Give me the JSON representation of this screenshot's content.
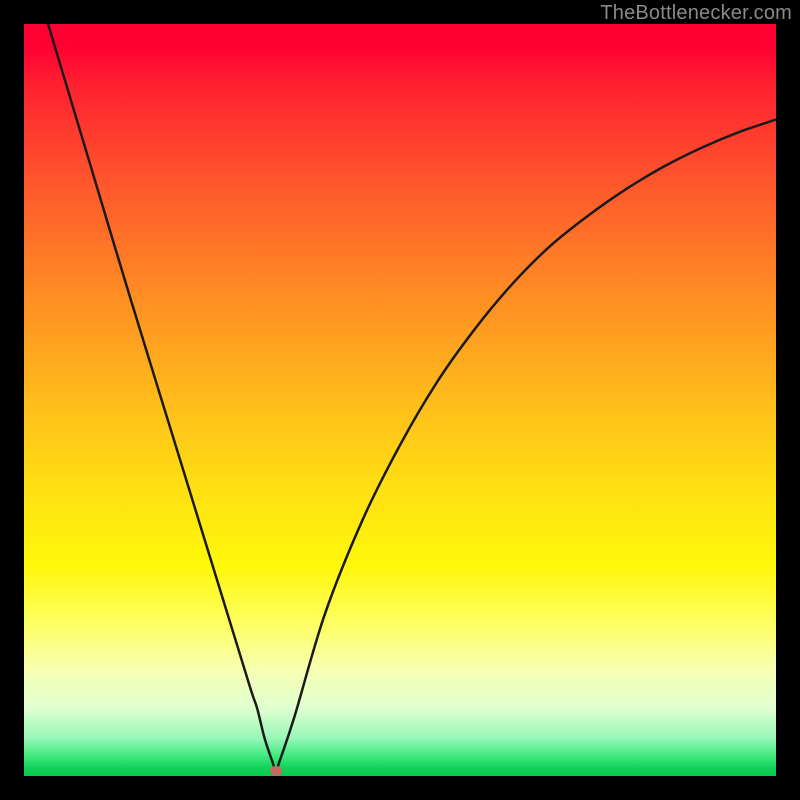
{
  "watermark": "TheBottlenecker.com",
  "chart_data": {
    "type": "line",
    "title": "",
    "xlabel": "",
    "ylabel": "",
    "xlim": [
      0,
      100
    ],
    "ylim": [
      0,
      100
    ],
    "grid": false,
    "legend": false,
    "series": [
      {
        "name": "bottleneck-curve",
        "x": [
          3.2,
          8,
          14,
          20,
          26,
          30,
          31,
          32,
          33,
          33.5,
          34,
          36,
          40,
          45,
          50,
          55,
          60,
          65,
          70,
          75,
          80,
          85,
          90,
          95,
          100
        ],
        "y": [
          100,
          84,
          64,
          44.5,
          25,
          12,
          9,
          5,
          2,
          0.7,
          2,
          8,
          21.5,
          34,
          44,
          52.5,
          59.5,
          65.5,
          70.5,
          74.5,
          78,
          81,
          83.5,
          85.6,
          87.3
        ]
      }
    ],
    "marker": {
      "x": 33.5,
      "y": 0.7
    },
    "gradient_stops": [
      {
        "pct": 0,
        "color": "#ff0033"
      },
      {
        "pct": 35,
        "color": "#ff8924"
      },
      {
        "pct": 60,
        "color": "#ffdb14"
      },
      {
        "pct": 86,
        "color": "#f6ffb2"
      },
      {
        "pct": 100,
        "color": "#07c94f"
      }
    ]
  }
}
